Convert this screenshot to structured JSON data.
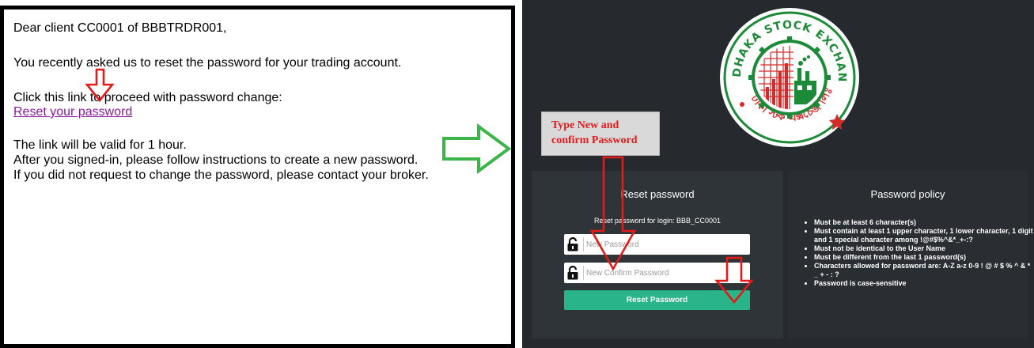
{
  "email": {
    "greeting": "Dear client CC0001 of BBBTRDR001,",
    "line1": "You recently asked us to reset the password for your trading account.",
    "line2": "Click this link to proceed with password change:",
    "link_text": "Reset your password",
    "line3": "The link will be valid for 1 hour.",
    "line4": "After you signed-in, please follow instructions to create a new password.",
    "line5": "If you did not request to change the password, please contact your broker."
  },
  "logo": {
    "text_en": "DHAKA STOCK EXCHANGE LTD.",
    "text_bn": "ঢাকা স্টক এক্সচেঞ্জ লিঃ"
  },
  "annotation": {
    "line1": "Type New and",
    "line2": "confirm Password"
  },
  "reset": {
    "title": "Reset password",
    "subtitle": "Reset password for login: BBB_CC0001",
    "new_password_placeholder": "New Password",
    "confirm_password_placeholder": "New Confirm Password",
    "button_label": "Reset Password"
  },
  "policy": {
    "title": "Password policy",
    "rules": [
      "Must be at least 6 character(s)",
      "Must contain at least 1 upper character, 1 lower character, 1 digit and 1 special character among !@#$%^&*_+-:?",
      "Must not be identical to the User Name",
      "Must be different from the last 1 password(s)",
      "Characters allowed for password are: A-Z a-z 0-9 ! @ # $ % ^ & * _ + - : ?",
      "Password is case-sensitive"
    ]
  },
  "colors": {
    "app_background": "#262a2e",
    "panel_background": "#2f3438",
    "button_green": "#2ab48a",
    "annotation_red": "#e31b1b",
    "arrow_green": "#3bb54a",
    "link_purple": "#8a1a9b",
    "logo_red": "#d42a2a",
    "logo_green": "#1d8a3a"
  },
  "icons": {
    "lock": "lock-icon",
    "arrow_right": "arrow-right-icon",
    "arrow_down": "arrow-down-icon"
  }
}
